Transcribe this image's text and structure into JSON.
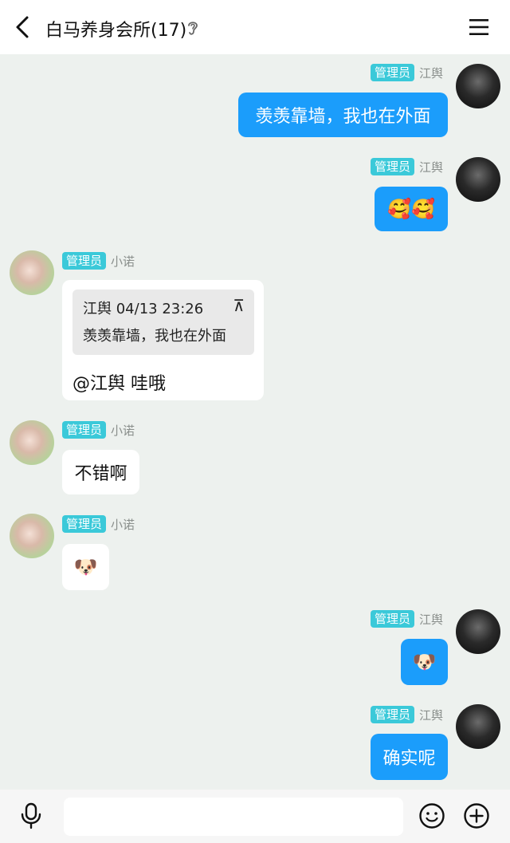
{
  "header": {
    "title": "白马养身会所(17)"
  },
  "messages": [
    {
      "side": "right",
      "badge": "管理员",
      "sender": "江舆",
      "text": "羡羡靠墙，我也在外面"
    },
    {
      "side": "right",
      "badge": "管理员",
      "sender": "江舆",
      "emoji": "🥰🥰"
    },
    {
      "side": "left",
      "badge": "管理员",
      "sender": "小诺",
      "quote": {
        "author": "江舆",
        "time": "04/13 23:26",
        "text": "羡羡靠墙，我也在外面"
      },
      "text": "@江舆 哇哦"
    },
    {
      "side": "left",
      "badge": "管理员",
      "sender": "小诺",
      "text": "不错啊"
    },
    {
      "side": "left",
      "badge": "管理员",
      "sender": "小诺",
      "emoji": "🐶"
    },
    {
      "side": "right",
      "badge": "管理员",
      "sender": "江舆",
      "emoji": "🐶"
    },
    {
      "side": "right",
      "badge": "管理员",
      "sender": "江舆",
      "text": "确实呢"
    }
  ],
  "quote_header": "江舆 04/13 23:26",
  "quote_pin_glyph": "⊼",
  "icons": {
    "back": "chevron-left-icon",
    "ear": "ear-icon",
    "menu": "menu-icon",
    "mic": "microphone-icon",
    "smile": "smile-icon",
    "plus": "plus-circle-icon"
  },
  "colors": {
    "background": "#edf1ee",
    "bubble_blue": "#1b9dfb",
    "badge": "#3bc9d9"
  },
  "input": {
    "value": "",
    "placeholder": ""
  }
}
